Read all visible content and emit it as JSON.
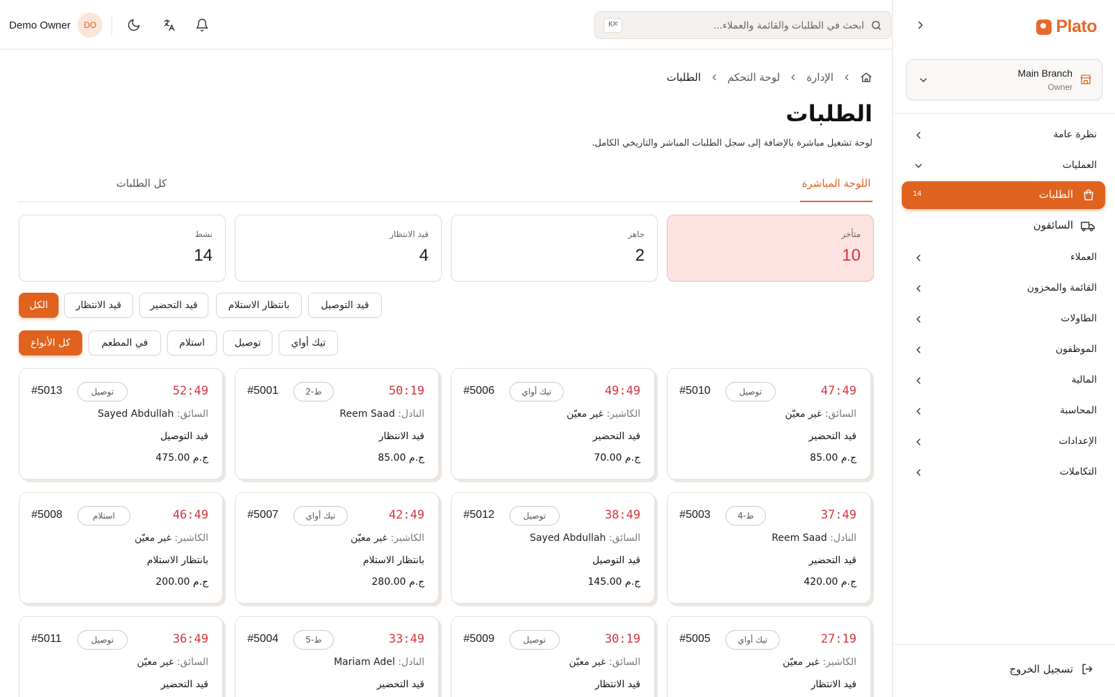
{
  "brand": {
    "name": "Plato",
    "accent": "#e0621f",
    "danger": "#d4333b"
  },
  "branch": {
    "name": "Main Branch",
    "role": "Owner"
  },
  "sidebar": {
    "items": [
      {
        "label": "نظرة عامة",
        "icon": "chevron-left-icon"
      },
      {
        "label": "العمليات",
        "icon": "chevron-down-icon"
      },
      {
        "label": "الطلبات",
        "icon": "shopping-bag-icon",
        "badge": "14",
        "active": true
      },
      {
        "label": "السائقون",
        "icon": "truck-icon"
      },
      {
        "label": "العملاء",
        "icon": "chevron-left-icon"
      },
      {
        "label": "القائمة والمخزون",
        "icon": "chevron-left-icon"
      },
      {
        "label": "الطاولات",
        "icon": "chevron-left-icon"
      },
      {
        "label": "الموظفون",
        "icon": "chevron-left-icon"
      },
      {
        "label": "المالية",
        "icon": "chevron-left-icon"
      },
      {
        "label": "المحاسبة",
        "icon": "chevron-left-icon"
      },
      {
        "label": "الإعدادات",
        "icon": "chevron-left-icon"
      },
      {
        "label": "التكاملات",
        "icon": "chevron-left-icon"
      }
    ],
    "logout": "تسجيل الخروج"
  },
  "header": {
    "user_name": "Demo Owner",
    "avatar_initials": "DO",
    "search_placeholder": "ابحث في الطلبات والقائمة والعملاء...",
    "shortcut": "K⌘"
  },
  "breadcrumb": [
    "الإدارة",
    "لوحة التحكم",
    "الطلبات"
  ],
  "page": {
    "title": "الطلبات",
    "subtitle": "لوحة تشغيل مباشرة بالإضافة إلى سجل الطلبات المباشر والتاريخي الكامل."
  },
  "tabs": [
    {
      "label": "اللوحة المباشرة",
      "active": true
    },
    {
      "label": "كل الطلبات",
      "active": false
    }
  ],
  "stats": [
    {
      "label": "متأخر",
      "value": "10"
    },
    {
      "label": "جاهز",
      "value": "2"
    },
    {
      "label": "قيد الانتظار",
      "value": "4"
    },
    {
      "label": "نشط",
      "value": "14"
    }
  ],
  "status_filters": [
    "الكل",
    "قيد الانتظار",
    "قيد التحضير",
    "بانتظار الاستلام",
    "قيد التوصيل"
  ],
  "type_filters": [
    "كل الأنواع",
    "في المطعم",
    "استلام",
    "توصيل",
    "تيك أواي"
  ],
  "orders": [
    {
      "timer": "47:49",
      "tag": "توصيل",
      "number": "#5010",
      "role": "السائق:",
      "person": "غير معيّن",
      "status": "قيد التحضير",
      "price": "ج.م 85.00"
    },
    {
      "timer": "49:49",
      "tag": "تيك أواي",
      "number": "#5006",
      "role": "الكاشير:",
      "person": "غير معيّن",
      "status": "قيد التحضير",
      "price": "ج.م 70.00"
    },
    {
      "timer": "50:19",
      "tag": "ط-2",
      "number": "#5001",
      "role": "النادل:",
      "person": "Reem Saad",
      "status": "قيد الانتظار",
      "price": "ج.م 85.00"
    },
    {
      "timer": "52:49",
      "tag": "توصيل",
      "number": "#5013",
      "role": "السائق:",
      "person": "Sayed Abdullah",
      "status": "قيد التوصيل",
      "price": "ج.م 475.00"
    },
    {
      "timer": "37:49",
      "tag": "ط-4",
      "number": "#5003",
      "role": "النادل:",
      "person": "Reem Saad",
      "status": "قيد التحضير",
      "price": "ج.م 420.00"
    },
    {
      "timer": "38:49",
      "tag": "توصيل",
      "number": "#5012",
      "role": "السائق:",
      "person": "Sayed Abdullah",
      "status": "قيد التوصيل",
      "price": "ج.م 145.00"
    },
    {
      "timer": "42:49",
      "tag": "تيك أواي",
      "number": "#5007",
      "role": "الكاشير:",
      "person": "غير معيّن",
      "status": "بانتظار الاستلام",
      "price": "ج.م 280.00"
    },
    {
      "timer": "46:49",
      "tag": "استلام",
      "number": "#5008",
      "role": "الكاشير:",
      "person": "غير معيّن",
      "status": "بانتظار الاستلام",
      "price": "ج.م 200.00"
    },
    {
      "timer": "27:19",
      "tag": "تيك أواي",
      "number": "#5005",
      "role": "الكاشير:",
      "person": "غير معيّن",
      "status": "قيد الانتظار",
      "price": ""
    },
    {
      "timer": "30:19",
      "tag": "توصيل",
      "number": "#5009",
      "role": "السائق:",
      "person": "غير معيّن",
      "status": "قيد الانتظار",
      "price": ""
    },
    {
      "timer": "33:49",
      "tag": "ط-5",
      "number": "#5004",
      "role": "النادل:",
      "person": "Mariam Adel",
      "status": "قيد التحضير",
      "price": ""
    },
    {
      "timer": "36:49",
      "tag": "توصيل",
      "number": "#5011",
      "role": "السائق:",
      "person": "غير معيّن",
      "status": "قيد التحضير",
      "price": ""
    }
  ]
}
